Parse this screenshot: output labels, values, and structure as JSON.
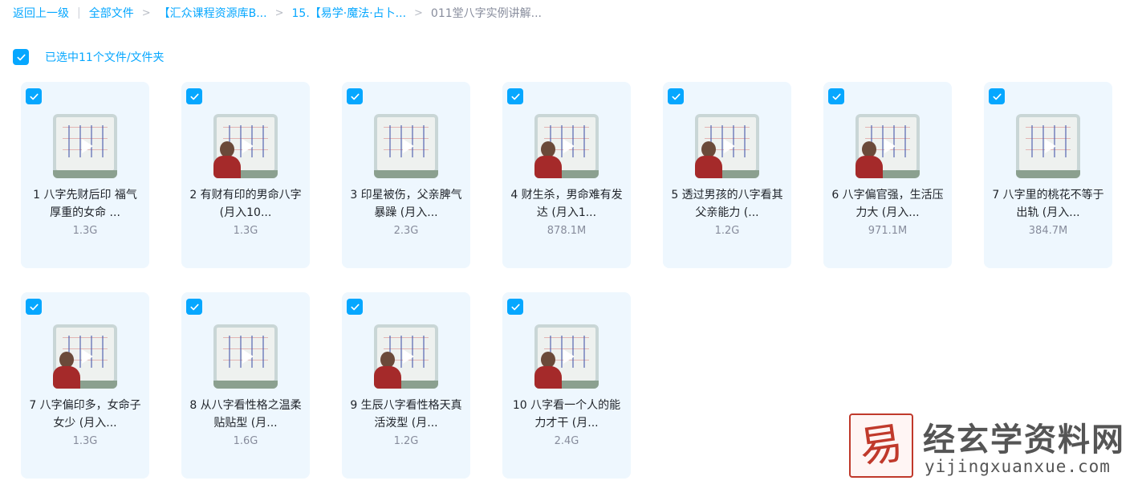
{
  "breadcrumb": {
    "back": "返回上一级",
    "items": [
      "全部文件",
      "【汇众课程资源库B...",
      "15.【易学·魔法·占卜...",
      "011堂八字实例讲解..."
    ]
  },
  "selection": {
    "label": "已选中11个文件/文件夹"
  },
  "files": [
    {
      "name": "1 八字先财后印 福气厚重的女命 ...",
      "size": "1.3G",
      "thumb": "board"
    },
    {
      "name": "2 有财有印的男命八字 (月入10...",
      "size": "1.3G",
      "thumb": "person"
    },
    {
      "name": "3 印星被伤，父亲脾气暴躁 (月入...",
      "size": "2.3G",
      "thumb": "board"
    },
    {
      "name": "4 财生杀，男命难有发达 (月入1...",
      "size": "878.1M",
      "thumb": "person"
    },
    {
      "name": "5 透过男孩的八字看其父亲能力 (...",
      "size": "1.2G",
      "thumb": "person"
    },
    {
      "name": "6 八字偏官强，生活压力大 (月入...",
      "size": "971.1M",
      "thumb": "person"
    },
    {
      "name": "7 八字里的桃花不等于出轨 (月入...",
      "size": "384.7M",
      "thumb": "board"
    },
    {
      "name": "7 八字偏印多，女命子女少 (月入...",
      "size": "1.3G",
      "thumb": "person"
    },
    {
      "name": "8 从八字看性格之温柔贴贴型 (月...",
      "size": "1.6G",
      "thumb": "board"
    },
    {
      "name": "9 生辰八字看性格天真活泼型 (月...",
      "size": "1.2G",
      "thumb": "person"
    },
    {
      "name": "10 八字看一个人的能力才干 (月...",
      "size": "2.4G",
      "thumb": "person"
    }
  ],
  "watermark": {
    "logo_char": "易",
    "title": "经玄学资料网",
    "url": "yijingxuanxue.com"
  },
  "colors": {
    "accent": "#06a7ff",
    "card_bg": "#eef7fe"
  }
}
